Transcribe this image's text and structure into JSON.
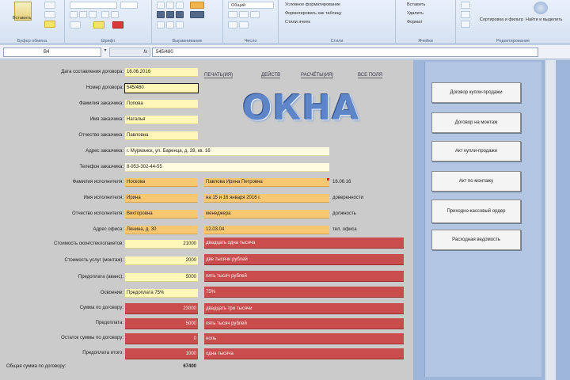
{
  "ribbon": {
    "groups": [
      {
        "name": "clipboard",
        "label": "Буфер обмена"
      },
      {
        "name": "font",
        "label": "Шрифт"
      },
      {
        "name": "alignment",
        "label": "Выравнивание"
      },
      {
        "name": "number",
        "label": "Число"
      },
      {
        "name": "styles",
        "label": "Стили"
      },
      {
        "name": "cells",
        "label": "Ячейки"
      },
      {
        "name": "editing",
        "label": "Редактирование"
      }
    ],
    "paste_label": "Вставить",
    "number_format": "Общий",
    "styles": {
      "conditional": "Условное форматирование",
      "as_table": "Форматировать как таблицу",
      "cell_styles": "Стили ячеек"
    },
    "cells": {
      "insert": "Вставить",
      "delete": "Удалить",
      "format": "Формат"
    },
    "editing": {
      "sort": "Сортировка и фильтр",
      "find": "Найти и выделить"
    }
  },
  "formula_bar": {
    "name_box": "B4",
    "fx": "fx",
    "value": "545/480"
  },
  "links": [
    "ПЕЧАТЬ(ИЯ)",
    "ДЕЙСТВ",
    "РАСЧЁТЫ(ИЯ)",
    "ВСЕ ПОЛЯ"
  ],
  "logo": "ОКНА",
  "contract_block": [
    {
      "label": "Дата составления договора:",
      "value": "16.06.2016"
    },
    {
      "label": "Номер договора:",
      "value": "545/480"
    },
    {
      "label": "Фамилия заказчика:",
      "value": "Попова"
    },
    {
      "label": "Имя заказчика:",
      "value": "Наталья"
    },
    {
      "label": "Отчество заказчика:",
      "value": "Павловна"
    },
    {
      "label": "Адрес заказчика:",
      "value": "г. Мурманск, ул. Баренца, д. 28, кв. 16"
    },
    {
      "label": "Телефон заказчика:",
      "value": "8-953-302-44-55"
    }
  ],
  "installer_block": [
    {
      "label": "Фамилия исполнителя:",
      "value": "Носкова",
      "extra": "Павлова Ирина Петровна",
      "suffix": "16.06.16"
    },
    {
      "label": "Имя исполнителя:",
      "value": "Ирина",
      "extra": "на 15 и 16 января 2016 г.",
      "suffix": "доверенности"
    },
    {
      "label": "Отчество исполнителя:",
      "value": "Викторовна",
      "extra": "менеджера",
      "suffix": "должность"
    },
    {
      "label": "Адрес офиса:",
      "value": "Ленина, д. 30",
      "extra": "12.03.04",
      "suffix": "тел. офиса"
    }
  ],
  "finance_block": [
    {
      "label": "Стоимость окон/стеклопакетов:",
      "value": "21000",
      "note": "двадцать одна тысяча"
    },
    {
      "label": "Стоимость услуг (монтаж):",
      "value": "2000",
      "note": "две тысячи рублей"
    },
    {
      "label": "Предоплата (аванс):",
      "value": "5000",
      "note": "пять тысяч рублей"
    },
    {
      "label": "Освоение:",
      "value": "Предоплата 75%",
      "note": "75%"
    },
    {
      "label": "Сумма по договору:",
      "value": "23000",
      "note": "двадцать три тысячи"
    },
    {
      "label": "Предоплата:",
      "value": "5000",
      "note": "пять тысяч рублей"
    },
    {
      "label": "Остаток суммы по договору:",
      "value": "0",
      "note": "ноль"
    },
    {
      "label": "Предоплата итого:",
      "value": "1000",
      "note": "одна тысяча"
    }
  ],
  "total": {
    "label": "Общая сумма по договору:",
    "value": "67400"
  },
  "side_buttons": [
    "Договор купли-продажи",
    "Договор на монтаж",
    "Акт купли-продажи",
    "Акт по монтажу",
    "Приходно-кассовый ордер",
    "Расходная ведомость"
  ]
}
